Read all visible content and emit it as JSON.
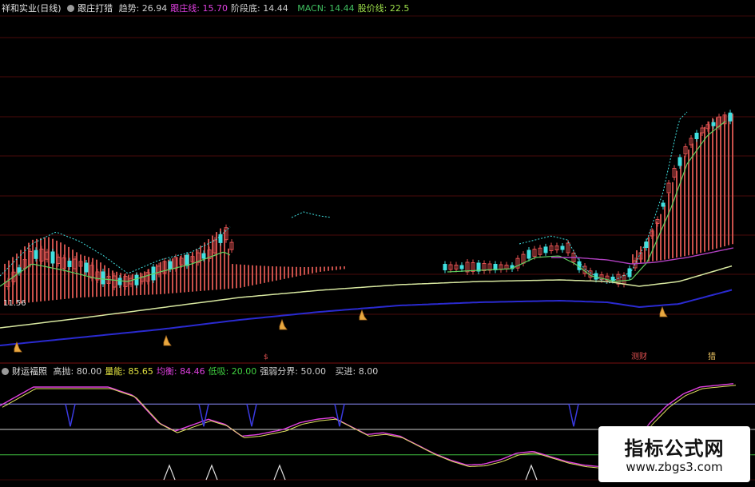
{
  "main_header": {
    "stock": "祥和实业(日线)",
    "indicator": "跟庄打猎",
    "items": [
      {
        "label": "趋势:",
        "value": "26.94",
        "color": "#d0d0d0"
      },
      {
        "label": "跟庄线:",
        "value": "15.70",
        "color": "#e040e0"
      },
      {
        "label": "阶段底:",
        "value": "14.44",
        "color": "#d0d0d0"
      },
      {
        "label": "",
        "value": "",
        "color": "#3a3ae0"
      },
      {
        "label": "MACN:",
        "value": "14.44",
        "color": "#40c060"
      },
      {
        "label": "股价线:",
        "value": "22.5",
        "color": "#9ee04a"
      }
    ]
  },
  "sub_header": {
    "indicator": "财运福照",
    "items": [
      {
        "label": "高抛:",
        "value": "80.00",
        "color": "#d0d0d0"
      },
      {
        "label": "量能:",
        "value": "85.65",
        "color": "#e0e040"
      },
      {
        "label": "均衡:",
        "value": "84.46",
        "color": "#e040e0"
      },
      {
        "label": "低吸:",
        "value": "20.00",
        "color": "#40d040"
      },
      {
        "label": "强弱分界:",
        "value": "50.00",
        "color": "#d0d0d0"
      },
      {
        "label": "",
        "value": "",
        "color": "#3a3ae0"
      },
      {
        "label": "买进:",
        "value": "8.00",
        "color": "#d0d0d0"
      }
    ]
  },
  "price_axis_label": "11.56",
  "signal_labels": [
    "测财",
    "猎"
  ],
  "watermark": {
    "title": "指标公式网",
    "url": "www.zbgs3.com"
  },
  "chart_data": [
    {
      "type": "candlestick",
      "title": "跟庄打猎",
      "series": [
        {
          "name": "跟庄线",
          "color": "#e040e0"
        },
        {
          "name": "阶段底",
          "color": "#d0d0d0"
        },
        {
          "name": "MACN",
          "color": "#40c060"
        },
        {
          "name": "股价线",
          "color": "#9ee04a"
        }
      ],
      "last_values": {
        "趋势": 26.94,
        "跟庄线": 15.7,
        "阶段底": 14.44,
        "MACN": 14.44,
        "股价线": 22.5
      },
      "visible_low_label": 11.56
    },
    {
      "type": "line",
      "title": "财运福照",
      "levels": {
        "高抛": 80.0,
        "低吸": 20.0,
        "强弱分界": 50.0,
        "买进": 8.0
      },
      "last_values": {
        "量能": 85.65,
        "均衡": 84.46
      },
      "ylim": [
        0,
        100
      ],
      "trend_keypoints": [
        [
          0,
          78
        ],
        [
          4,
          100
        ],
        [
          9,
          100
        ],
        [
          13,
          100
        ],
        [
          16,
          90
        ],
        [
          19,
          58
        ],
        [
          21,
          48
        ],
        [
          23,
          55
        ],
        [
          25,
          62
        ],
        [
          27,
          56
        ],
        [
          29,
          42
        ],
        [
          31,
          44
        ],
        [
          34,
          50
        ],
        [
          36,
          58
        ],
        [
          38,
          62
        ],
        [
          40,
          64
        ],
        [
          42,
          54
        ],
        [
          44,
          44
        ],
        [
          46,
          46
        ],
        [
          48,
          42
        ],
        [
          50,
          32
        ],
        [
          52,
          22
        ],
        [
          54,
          14
        ],
        [
          56,
          8
        ],
        [
          58,
          9
        ],
        [
          60,
          14
        ],
        [
          62,
          22
        ],
        [
          64,
          24
        ],
        [
          66,
          18
        ],
        [
          68,
          12
        ],
        [
          70,
          8
        ],
        [
          72,
          6
        ],
        [
          74,
          14
        ],
        [
          76,
          32
        ],
        [
          78,
          58
        ],
        [
          80,
          78
        ],
        [
          82,
          92
        ],
        [
          84,
          100
        ],
        [
          86,
          102
        ],
        [
          88,
          104
        ]
      ]
    }
  ]
}
